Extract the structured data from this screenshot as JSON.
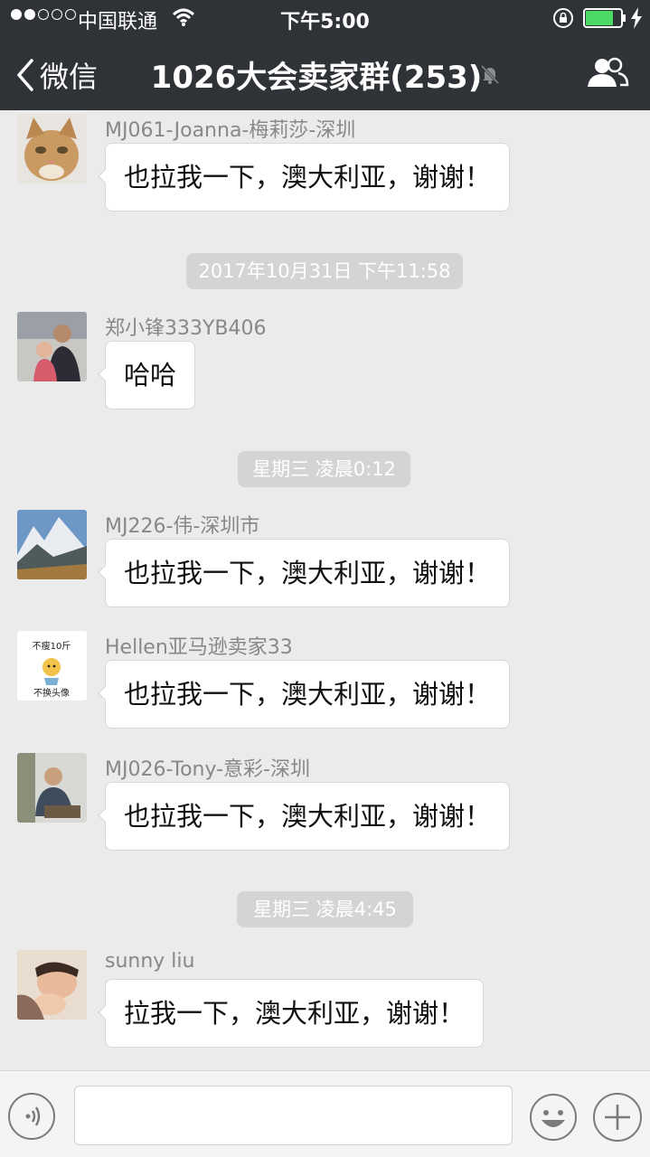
{
  "status_bar": {
    "carrier": "中国联通",
    "time": "下午5:00",
    "signal_bars": 2,
    "battery_level": 0.8
  },
  "nav": {
    "back_label": "微信",
    "title": "1026大会卖家群(253)",
    "muted": true
  },
  "messages": [
    {
      "type": "message",
      "sender": "MJ061-Joanna-梅莉莎-深圳",
      "text": "也拉我一下，澳大利亚，谢谢！",
      "avatar": "cat-avatar"
    },
    {
      "type": "time",
      "text": "2017年10月31日 下午11:58"
    },
    {
      "type": "message",
      "sender": "郑小锋333YB406",
      "text": "哈哈",
      "avatar": "family-photo-avatar"
    },
    {
      "type": "time",
      "text": "星期三 凌晨0:12"
    },
    {
      "type": "message",
      "sender": "MJ226-伟-深圳市",
      "text": "也拉我一下，澳大利亚，谢谢！",
      "avatar": "mountain-avatar"
    },
    {
      "type": "message",
      "sender": "Hellen亚马逊卖家33",
      "text": "也拉我一下，澳大利亚，谢谢！",
      "avatar": "cartoon-avatar"
    },
    {
      "type": "message",
      "sender": "MJ026-Tony-意彩-深圳",
      "text": "也拉我一下，澳大利亚，谢谢！",
      "avatar": "office-photo-avatar"
    },
    {
      "type": "time",
      "text": "星期三 凌晨4:45"
    },
    {
      "type": "message",
      "sender": "sunny liu",
      "text": "拉我一下，澳大利亚，谢谢！",
      "avatar": "baby-photo-avatar"
    }
  ],
  "avatar_texts": {
    "cartoon_top": "不瘦10斤",
    "cartoon_bottom": "不换头像"
  },
  "input": {
    "placeholder": ""
  },
  "colors": {
    "header_bg": "#2f3237",
    "chat_bg": "#ebebeb",
    "bubble_bg": "#ffffff",
    "time_pill_bg": "#d4d4d4",
    "battery_green": "#4cd964"
  }
}
